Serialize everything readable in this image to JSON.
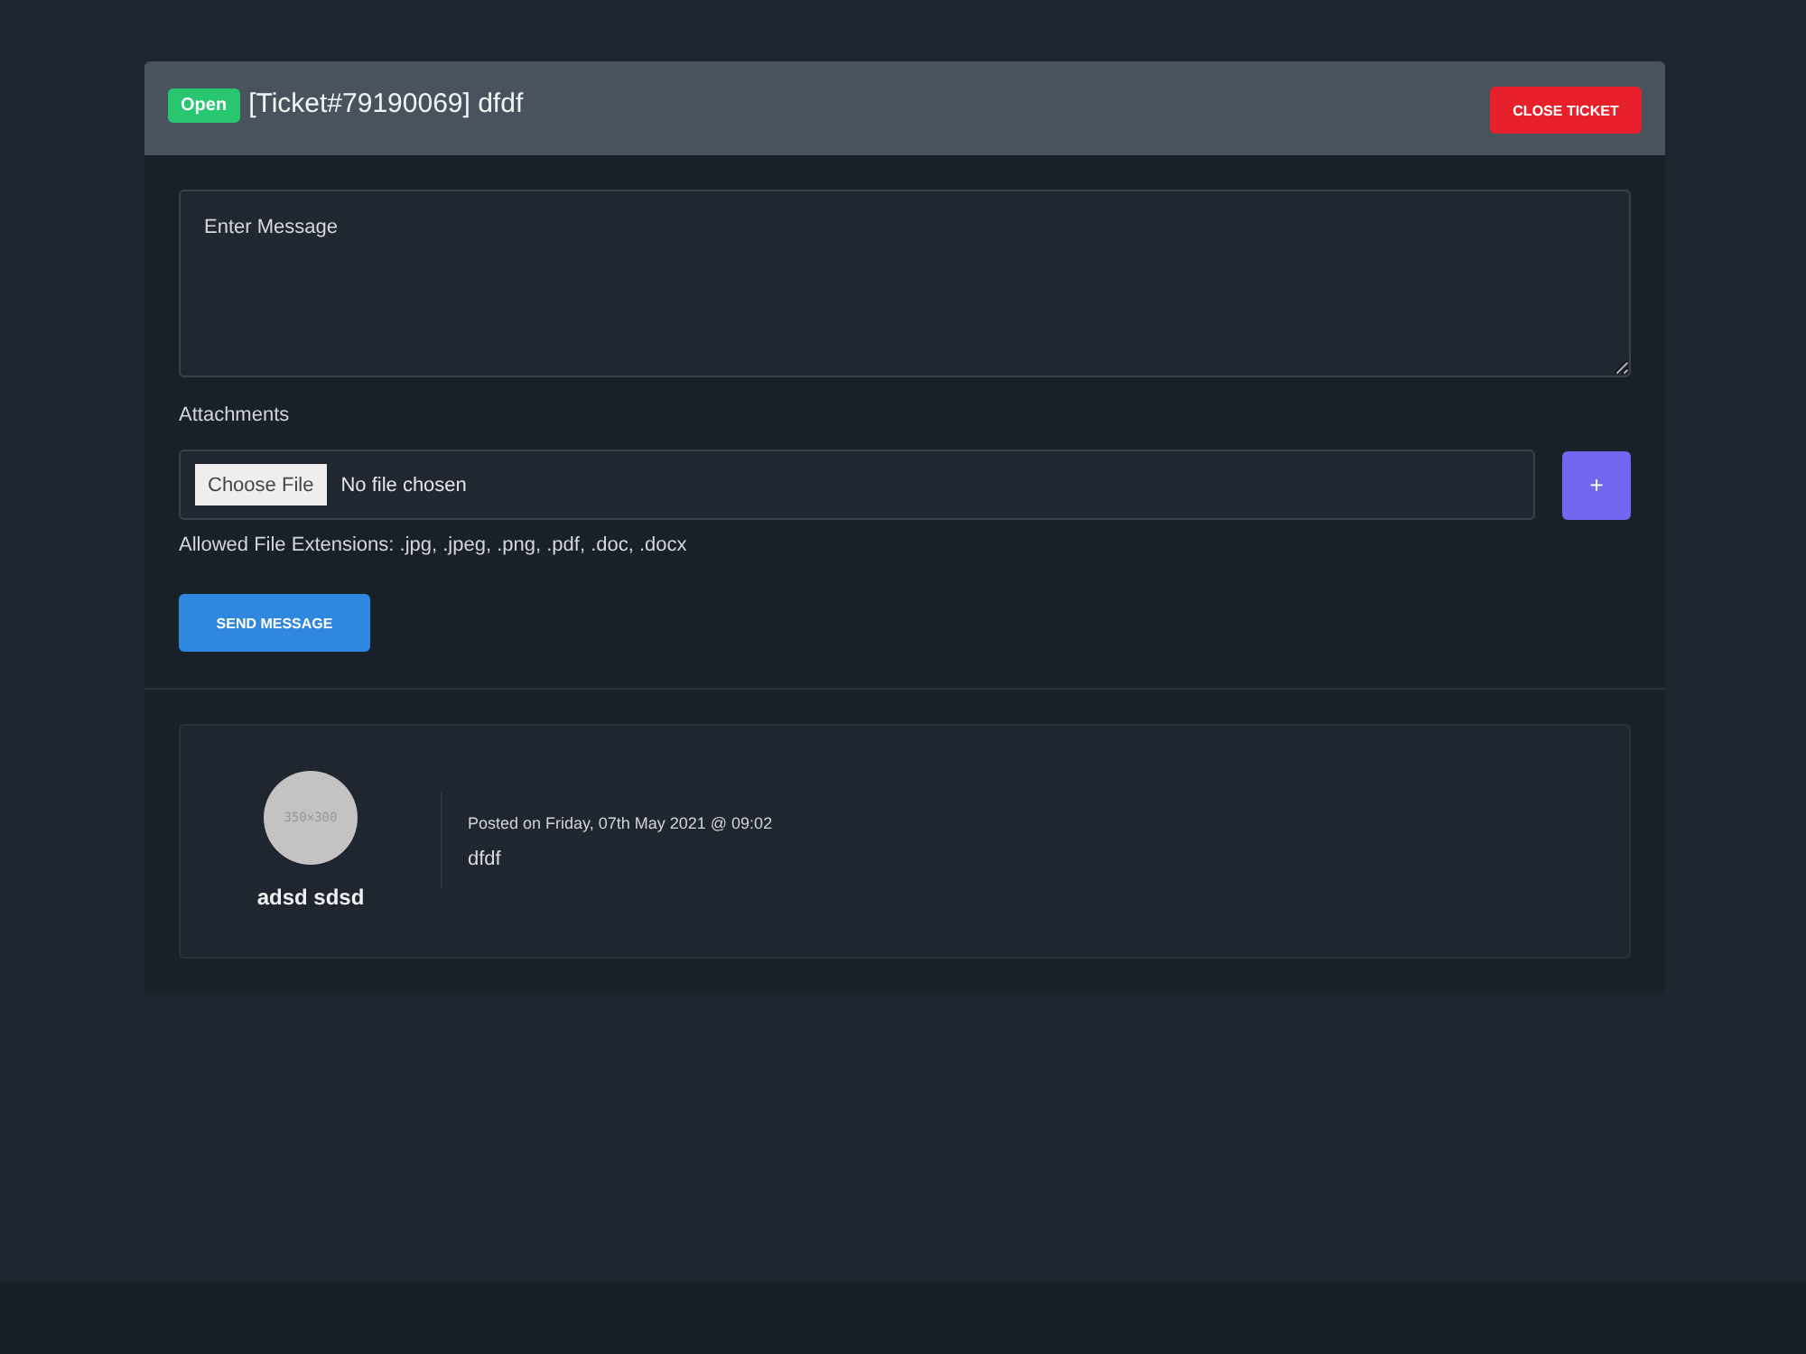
{
  "ticket": {
    "status": {
      "label": "Open",
      "kind": "open"
    },
    "title": "[Ticket#79190069] dfdf",
    "close_button": "CLOSE TICKET"
  },
  "reply_form": {
    "message": {
      "placeholder": "Enter Message"
    },
    "attachments": {
      "label": "Attachments",
      "file_input": {
        "button": "Choose File",
        "value": "No file chosen"
      },
      "add_button": "+",
      "hint": "Allowed File Extensions: .jpg, .jpeg, .png, .pdf, .doc, .docx"
    },
    "submit_button": "SEND MESSAGE"
  },
  "messages": [
    {
      "author": "adsd sdsd",
      "avatar_text": "350×300",
      "posted": "Posted on Friday, 07th May 2021 @ 09:02",
      "body": "dfdf"
    }
  ]
}
